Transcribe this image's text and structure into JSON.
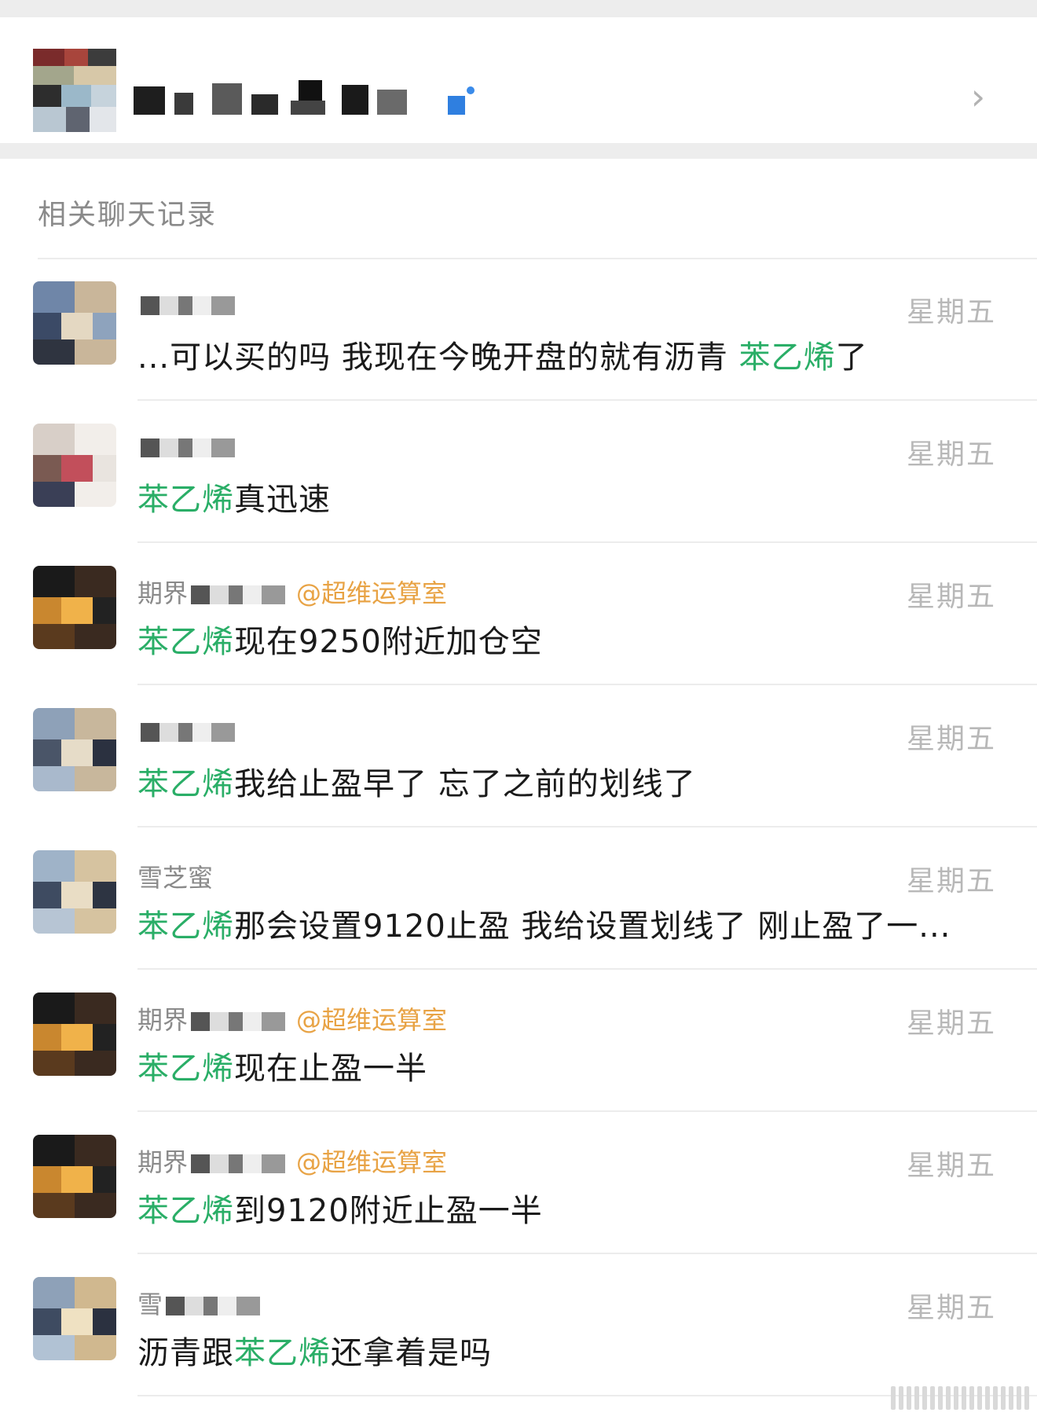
{
  "header": {
    "chevron_icon": "chevron-right-icon"
  },
  "section_title": "相关聊天记录",
  "colors": {
    "highlight": "#2aae67",
    "mention": "#e8a345",
    "meta_text": "#8a8a8a",
    "time_text": "#b8b8b8"
  },
  "results": [
    {
      "sender": "",
      "mention": "",
      "time": "星期五",
      "msg_before": "...可以买的吗  我现在今晚开盘的就有沥青 ",
      "msg_keyword": "苯乙烯",
      "msg_after": "了"
    },
    {
      "sender": "",
      "mention": "",
      "time": "星期五",
      "msg_before": "",
      "msg_keyword": "苯乙烯",
      "msg_after": "真迅速"
    },
    {
      "sender": "期界",
      "mention": "@超维运算室",
      "time": "星期五",
      "msg_before": "",
      "msg_keyword": "苯乙烯",
      "msg_after": "现在9250附近加仓空"
    },
    {
      "sender": "",
      "mention": "",
      "time": "星期五",
      "msg_before": "",
      "msg_keyword": "苯乙烯",
      "msg_after": "我给止盈早了 忘了之前的划线了"
    },
    {
      "sender": "雪芝蜜",
      "mention": "",
      "time": "星期五",
      "msg_before": "",
      "msg_keyword": "苯乙烯",
      "msg_after": "那会设置9120止盈  我给设置划线了  刚止盈了一..."
    },
    {
      "sender": "期界",
      "mention": "@超维运算室",
      "time": "星期五",
      "msg_before": "",
      "msg_keyword": "苯乙烯",
      "msg_after": "现在止盈一半"
    },
    {
      "sender": "期界",
      "mention": "@超维运算室",
      "time": "星期五",
      "msg_before": "",
      "msg_keyword": "苯乙烯",
      "msg_after": "到9120附近止盈一半"
    },
    {
      "sender": "雪",
      "mention": "",
      "time": "星期五",
      "msg_before": "沥青跟",
      "msg_keyword": "苯乙烯",
      "msg_after": "还拿着是吗"
    }
  ]
}
